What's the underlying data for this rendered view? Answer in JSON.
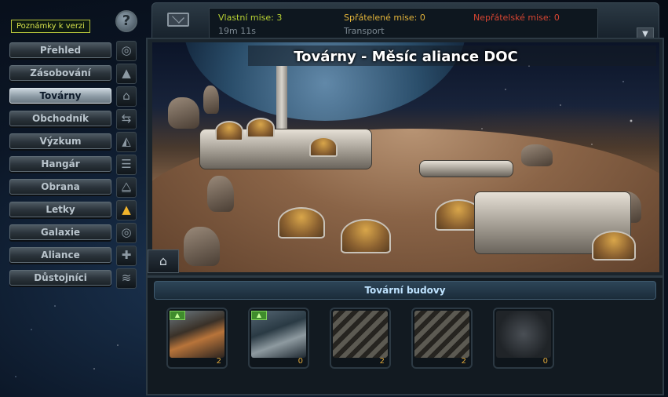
{
  "version_notes": "Poznámky k verzi",
  "help_icon": "?",
  "nav": [
    {
      "label": "Přehled",
      "icon": "overview-icon",
      "glyph": "◎",
      "active": false,
      "highlight": false
    },
    {
      "label": "Zásobování",
      "icon": "supply-icon",
      "glyph": "▲",
      "active": false,
      "highlight": false
    },
    {
      "label": "Továrny",
      "icon": "factory-icon",
      "glyph": "⌂",
      "active": true,
      "highlight": false
    },
    {
      "label": "Obchodník",
      "icon": "trade-icon",
      "glyph": "⇆",
      "active": false,
      "highlight": false
    },
    {
      "label": "Výzkum",
      "icon": "research-icon",
      "glyph": "◭",
      "active": false,
      "highlight": false
    },
    {
      "label": "Hangár",
      "icon": "hangar-icon",
      "glyph": "☰",
      "active": false,
      "highlight": false
    },
    {
      "label": "Obrana",
      "icon": "defense-icon",
      "glyph": "⧋",
      "active": false,
      "highlight": false
    },
    {
      "label": "Letky",
      "icon": "fleet-icon",
      "glyph": "▲",
      "active": false,
      "highlight": true
    },
    {
      "label": "Galaxie",
      "icon": "galaxy-icon",
      "glyph": "◎",
      "active": false,
      "highlight": false
    },
    {
      "label": "Aliance",
      "icon": "alliance-icon",
      "glyph": "✚",
      "active": false,
      "highlight": false
    },
    {
      "label": "Důstojníci",
      "icon": "officers-icon",
      "glyph": "≋",
      "active": false,
      "highlight": false
    }
  ],
  "missions": {
    "own": "Vlastní mise: 3",
    "friendly": "Spřátelené mise: 0",
    "enemy": "Nepřátelské mise: 0",
    "timer": "19m 11s",
    "mission_type": "Transport",
    "colors": {
      "own": "#b8d234",
      "friendly": "#e1b33a",
      "enemy": "#d64532"
    }
  },
  "scene_title": "Továrny - Měsíc aliance DOC",
  "panel_title": "Tovární budovy",
  "buildings": [
    {
      "count": "2",
      "upgrade": true,
      "theme": "industry"
    },
    {
      "count": "0",
      "upgrade": true,
      "theme": "dock"
    },
    {
      "count": "2",
      "upgrade": false,
      "theme": "hazard"
    },
    {
      "count": "2",
      "upgrade": false,
      "theme": "hazard"
    },
    {
      "count": "0",
      "upgrade": false,
      "theme": "locked"
    }
  ]
}
